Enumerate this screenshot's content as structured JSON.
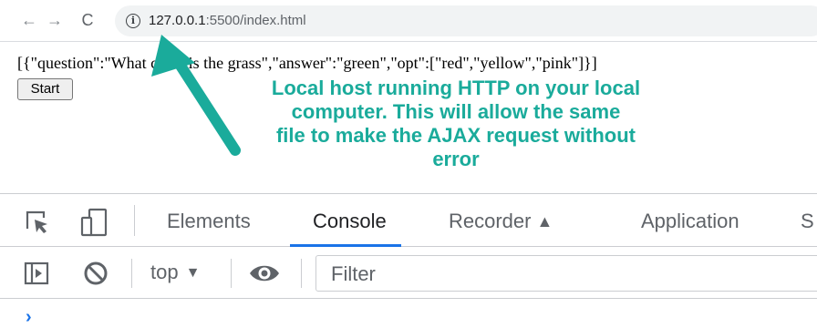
{
  "browser": {
    "nav": {
      "back": "←",
      "forward": "→",
      "reload": "C"
    },
    "url_host": "127.0.0.1",
    "url_path": ":5500/index.html"
  },
  "page": {
    "json_text": "[{\"question\":\"What color is the grass\",\"answer\":\"green\",\"opt\":[\"red\",\"yellow\",\"pink\"]}]",
    "start_button": "Start"
  },
  "annotation": {
    "lines": [
      "Local host running HTTP on your local",
      "computer.  This will allow the same",
      "file to make the AJAX request without",
      "error"
    ],
    "color": "#1aab9b"
  },
  "devtools": {
    "tabs": [
      "Elements",
      "Console",
      "Recorder",
      "Application",
      "S"
    ],
    "active_tab": "Console",
    "context": "top",
    "filter_placeholder": "Filter",
    "prompt": "›",
    "accent": "#1a73e8"
  }
}
